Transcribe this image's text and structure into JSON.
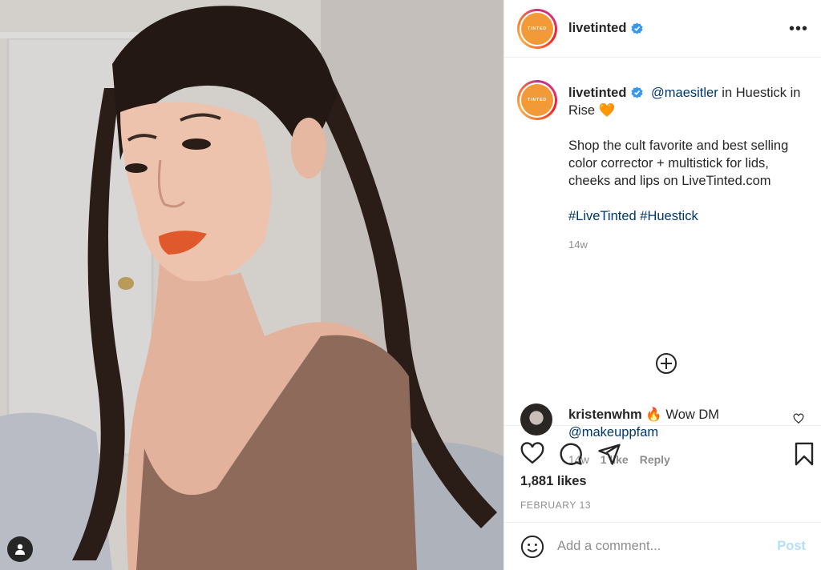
{
  "post": {
    "account": {
      "username": "livetinted",
      "logo_text": "TINTED",
      "brand_color": "#f29a38"
    },
    "caption": {
      "username": "livetinted",
      "mention": "@maesitler",
      "line1_rest": " in Huestick in Rise ",
      "heart_emoji": "🧡",
      "body": "Shop the cult favorite and best selling color corrector + multistick for lids, cheeks and lips on LiveTinted.com",
      "hashtags": "#LiveTinted #Huestick",
      "time": "14w"
    },
    "comment": {
      "username": "kristenwhm",
      "emoji": "🔥",
      "text": " Wow DM ",
      "mention": "@makeuppfam",
      "time": "14w",
      "likes": "1 like",
      "reply": "Reply"
    },
    "likes": "1,881 likes",
    "date": "FEBRUARY 13",
    "add_comment": {
      "placeholder": "Add a comment...",
      "post_label": "Post"
    }
  },
  "icons": {
    "header_more": "more-options-icon",
    "verified": "verified-badge-icon",
    "load_more": "plus-circle-icon",
    "like": "heart-icon",
    "comment": "comment-bubble-icon",
    "share": "paper-plane-icon",
    "save": "bookmark-icon",
    "emoji": "smiley-icon",
    "tags": "user-tag-icon"
  },
  "colors": {
    "link": "#00376b",
    "verified": "#3897f0",
    "post_disabled": "#b2dffc",
    "muted": "#8e8e8e"
  }
}
